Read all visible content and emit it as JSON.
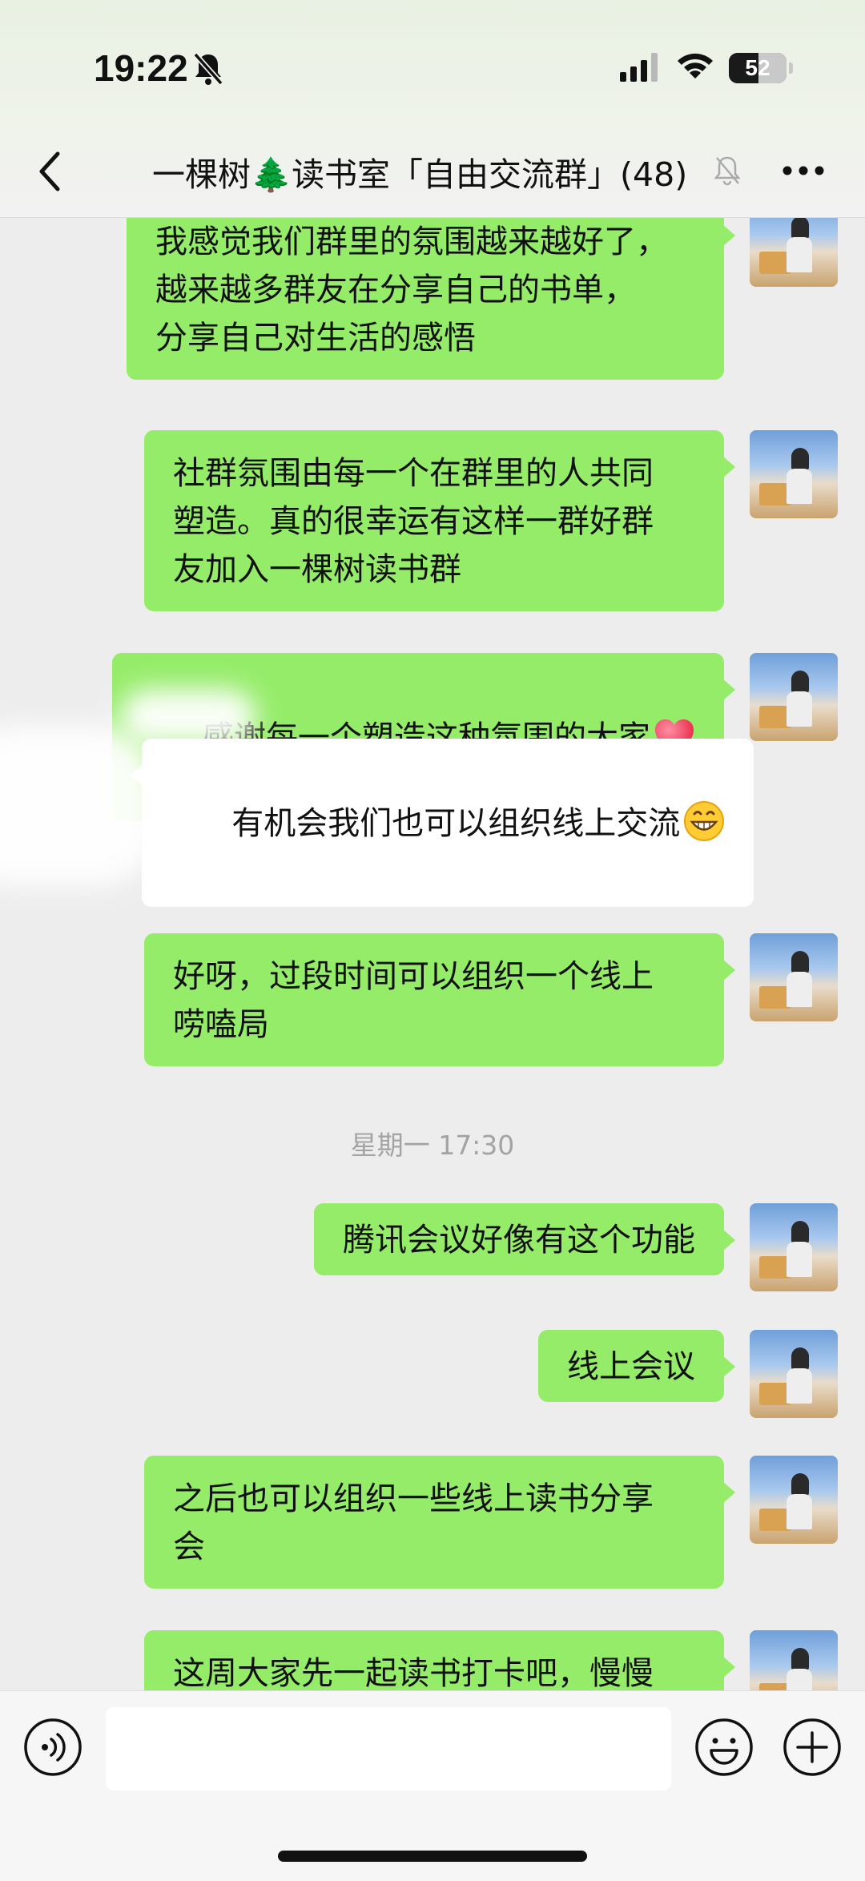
{
  "status_bar": {
    "time": "19:22",
    "battery": "52",
    "battery_level": 0.52
  },
  "header": {
    "title_part1": "一棵树",
    "title_part2": "读书室「自由交流群」(48)",
    "tree_emoji": "🌲",
    "icons": [
      "back-icon",
      "mute-icon",
      "more-icon"
    ]
  },
  "messages": [
    {
      "side": "right",
      "text": "我感觉我们群里的氛围越来越好了，\n越来越多群友在分享自己的书单，\n分享自己对生活的感悟"
    },
    {
      "side": "right",
      "text": "社群氛围由每一个在群里的人共同\n塑造。真的很幸运有这样一群好群\n友加入一棵树读书群"
    },
    {
      "side": "right",
      "text": "感谢每一个塑造这种氛围的大家",
      "emoji": "red-heart"
    },
    {
      "side": "left",
      "text": "有机会我们也可以组织线上交流",
      "emoji": "grinning-face"
    },
    {
      "side": "right",
      "text": "好呀，过段时间可以组织一个线上\n唠嗑局"
    },
    {
      "side": "right",
      "text": "腾讯会议好像有这个功能"
    },
    {
      "side": "right",
      "text": "线上会议"
    },
    {
      "side": "right",
      "text": "之后也可以组织一些线上读书分享\n会"
    },
    {
      "side": "right",
      "text": "这周大家先一起读书打卡吧，慢慢"
    }
  ],
  "timestamp": "星期一 17:30",
  "input": {
    "value": "",
    "placeholder": ""
  },
  "colors": {
    "outgoing_bubble": "#95ec69",
    "incoming_bubble": "#ffffff",
    "chat_background": "#ededed"
  }
}
